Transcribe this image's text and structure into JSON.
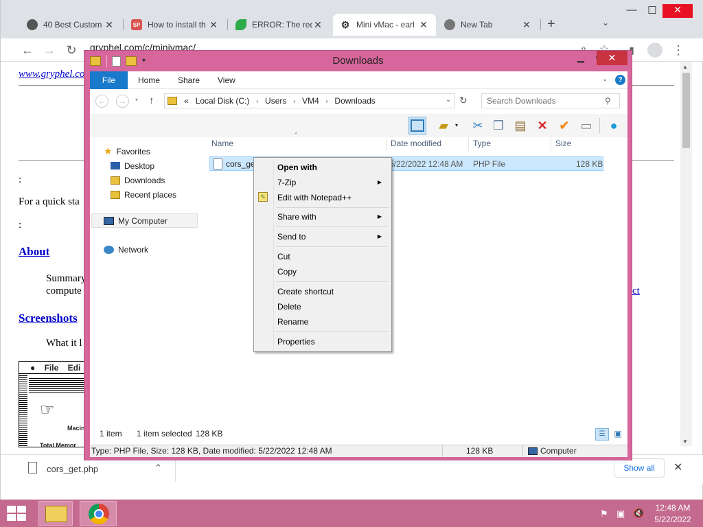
{
  "browser": {
    "tabs": [
      {
        "title": "40 Best Custom",
        "icon": "globe-icon"
      },
      {
        "title": "How to install th",
        "icon": "sp-favicon"
      },
      {
        "title": "ERROR: The requ",
        "icon": "leaf-icon"
      },
      {
        "title": "Mini vMac - earl",
        "icon": "minivmac-icon"
      },
      {
        "title": "New Tab",
        "icon": "chrome-icon"
      }
    ],
    "url": "gryphel.com/c/minivmac/"
  },
  "page": {
    "top_link": "www.gryphel.co",
    "colon1": ":",
    "quick_start": "For a quick sta",
    "colon2": ":",
    "about": "About",
    "summary_line1": "Summary",
    "summary_line2": "compute",
    "period_link": "ct",
    "screenshots": "Screenshots",
    "what_it": "What it l",
    "mac_menu_file": "File",
    "mac_menu_edit": "Edi",
    "mac_label": "Macin",
    "mac_total_mem": "Total Memor"
  },
  "download_bar": {
    "file": "cors_get.php",
    "show_all": "Show all"
  },
  "explorer": {
    "title": "Downloads",
    "ribbon": {
      "file": "File",
      "home": "Home",
      "share": "Share",
      "view": "View"
    },
    "address": {
      "prefix": "«",
      "parts": [
        "Local Disk (C:)",
        "Users",
        "VM4",
        "Downloads"
      ]
    },
    "search_placeholder": "Search Downloads",
    "nav": {
      "favorites": "Favorites",
      "desktop": "Desktop",
      "downloads": "Downloads",
      "recent": "Recent places",
      "computer": "My Computer",
      "network": "Network"
    },
    "columns": {
      "name": "Name",
      "date": "Date modified",
      "type": "Type",
      "size": "Size"
    },
    "file": {
      "name": "cors_get",
      "date": "5/22/2022 12:48 AM",
      "type": "PHP File",
      "size": "128 KB"
    },
    "status": {
      "items": "1 item",
      "selected": "1 item selected",
      "size": "128 KB"
    },
    "details_bar": {
      "info": "Type: PHP File, Size: 128 KB, Date modified: 5/22/2022 12:48 AM",
      "size": "128 KB",
      "location": "Computer"
    }
  },
  "context_menu": {
    "open_with": "Open with",
    "zip": "7-Zip",
    "notepad": "Edit with Notepad++",
    "share_with": "Share with",
    "send_to": "Send to",
    "cut": "Cut",
    "copy": "Copy",
    "create_shortcut": "Create shortcut",
    "delete": "Delete",
    "rename": "Rename",
    "properties": "Properties"
  },
  "taskbar": {
    "time": "12:48 AM",
    "date": "5/22/2022"
  }
}
